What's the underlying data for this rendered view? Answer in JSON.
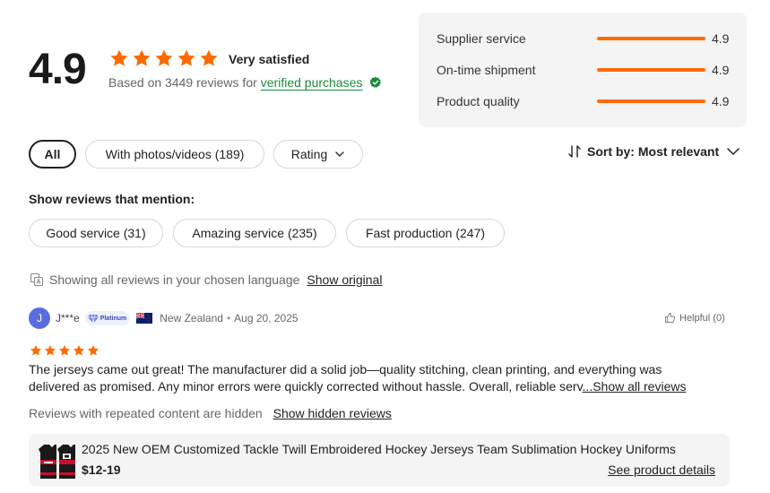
{
  "summary": {
    "score": "4.9",
    "stars": 5,
    "satisfaction_label": "Very satisfied",
    "based_on_text": "Based on 3449 reviews for",
    "verified_link": "verified purchases",
    "verified_icon": "verified-check-icon",
    "star_color": "#ff6a00"
  },
  "metrics": [
    {
      "label": "Supplier service",
      "value": "4.9",
      "fill": 0.98
    },
    {
      "label": "On-time shipment",
      "value": "4.9",
      "fill": 0.98
    },
    {
      "label": "Product quality",
      "value": "4.9",
      "fill": 0.98
    }
  ],
  "filters": {
    "all": "All",
    "photos": "With photos/videos (189)",
    "rating": "Rating",
    "active": "All"
  },
  "sort": {
    "prefix": "Sort by:",
    "value": "Most relevant",
    "icon": "sort-arrows-icon"
  },
  "mentions": {
    "title": "Show reviews that mention:",
    "tags": [
      "Good service (31)",
      "Amazing service (235)",
      "Fast production (247)"
    ]
  },
  "language": {
    "text": "Showing all reviews in your chosen language",
    "show_original": "Show original",
    "icon": "translate-icon"
  },
  "review": {
    "avatar_initial": "J",
    "name": "J***e",
    "badge": "Platinum",
    "country": "New Zealand",
    "separator": "•",
    "date": "Aug 20, 2025",
    "helpful": "Helpful (0)",
    "stars": 5,
    "text_line1": "The jerseys came out great! The manufacturer did a solid job—quality stitching, clean printing, and everything was",
    "text_line2": "delivered as promised. Any minor errors were quickly corrected without hassle. Overall, reliable serv",
    "show_all": "...Show all reviews"
  },
  "hidden": {
    "text": "Reviews with repeated content are hidden",
    "link": "Show hidden reviews"
  },
  "product": {
    "title": "2025 New OEM Customized Tackle Twill Embroidered Hockey Jerseys Team Sublimation Hockey Uniforms",
    "price": "$12-19",
    "details_link": "See product details"
  }
}
